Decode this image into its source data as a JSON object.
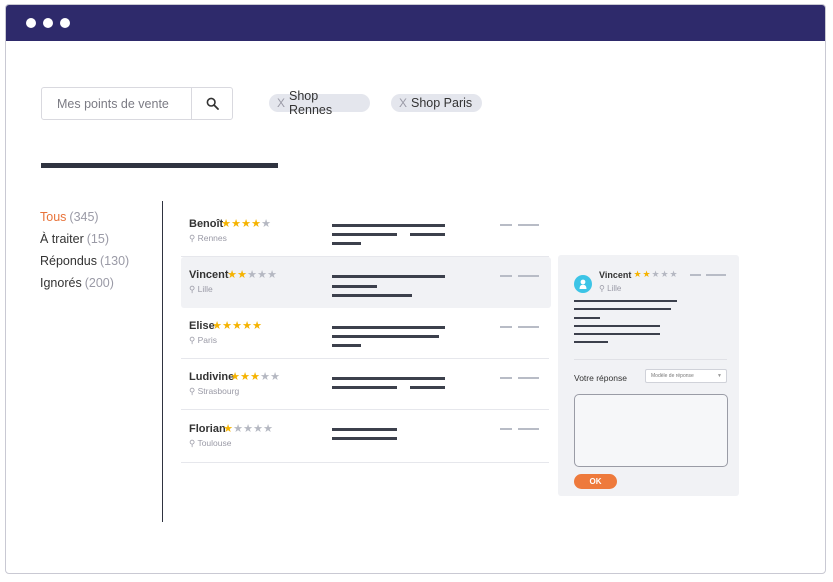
{
  "colors": {
    "titlebar": "#2e2a6b",
    "accent": "#e8733a",
    "star_on": "#f5b301",
    "star_off": "#b5b8c2",
    "ok_button": "#ee7a3c",
    "avatar": "#3cc4e6"
  },
  "search": {
    "placeholder": "Mes points de vente",
    "icon": "search-icon"
  },
  "chips": [
    {
      "label": "Shop Rennes",
      "remove_glyph": "X"
    },
    {
      "label": "Shop Paris",
      "remove_glyph": "X"
    }
  ],
  "filters": [
    {
      "label": "Tous",
      "count": "(345)",
      "active": true
    },
    {
      "label": "À traiter",
      "count": "(15)",
      "active": false
    },
    {
      "label": "Répondus",
      "count": "(130)",
      "active": false
    },
    {
      "label": "Ignorés",
      "count": "(200)",
      "active": false
    }
  ],
  "reviews": [
    {
      "name": "Benoît",
      "rating": 4,
      "location": "Rennes"
    },
    {
      "name": "Vincent",
      "rating": 2,
      "location": "Lille",
      "selected": true
    },
    {
      "name": "Elise",
      "rating": 5,
      "location": "Paris"
    },
    {
      "name": "Ludivine",
      "rating": 3,
      "location": "Strasbourg"
    },
    {
      "name": "Florian",
      "rating": 1,
      "location": "Toulouse"
    }
  ],
  "panel": {
    "name": "Vincent",
    "rating": 2,
    "location": "Lille",
    "response_label": "Votre réponse",
    "template_select": "Modèle de réponse",
    "ok_label": "OK"
  }
}
